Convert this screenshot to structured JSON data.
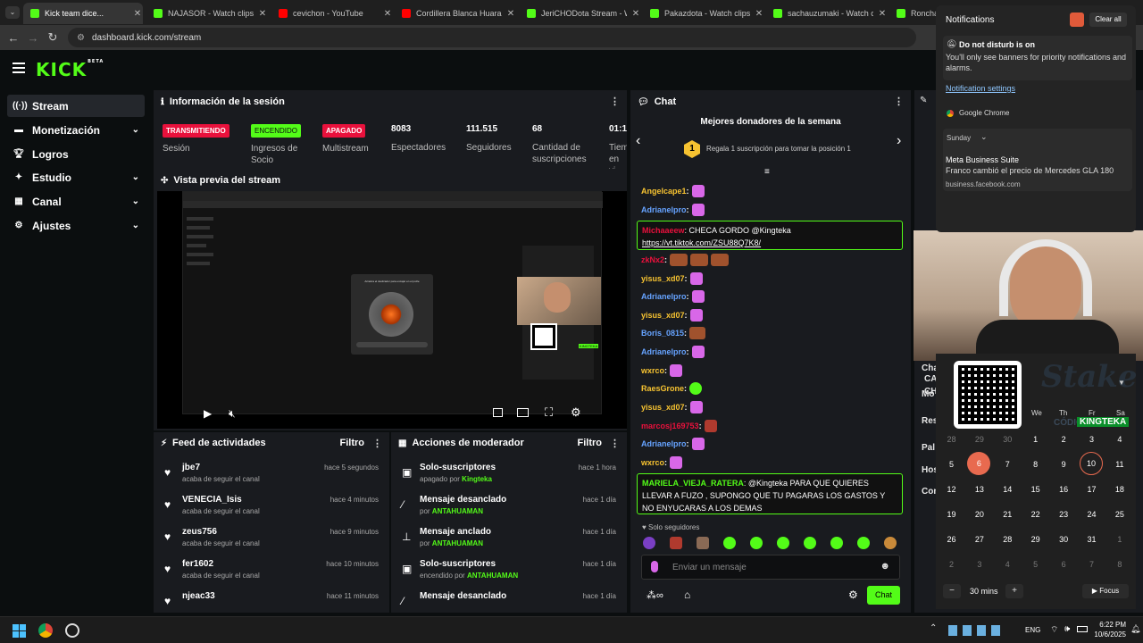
{
  "browser": {
    "tabs": [
      {
        "title": "Kick team dice...",
        "active": true,
        "fav": "#53fc18"
      },
      {
        "title": "NAJASOR - Watch clips o",
        "fav": "#53fc18"
      },
      {
        "title": "cevichon - YouTube",
        "fav": "#ff0000"
      },
      {
        "title": "Cordillera Blanca Huaraz",
        "fav": "#ff0000"
      },
      {
        "title": "JeriCHODota Stream - W",
        "fav": "#53fc18"
      },
      {
        "title": "Pakazdota - Watch clips o",
        "fav": "#53fc18"
      },
      {
        "title": "sachauzumaki - Watch cli",
        "fav": "#53fc18"
      },
      {
        "title": "Ronchas",
        "fav": "#53fc18"
      }
    ],
    "url": "dashboard.kick.com/stream"
  },
  "app": {
    "logo": "KICK",
    "logo_sup": "BETA"
  },
  "sidebar": {
    "items": [
      {
        "label": "Stream",
        "icon": "broadcast-icon"
      },
      {
        "label": "Monetización",
        "icon": "money-icon"
      },
      {
        "label": "Logros",
        "icon": "trophy-icon"
      },
      {
        "label": "Estudio",
        "icon": "studio-icon"
      },
      {
        "label": "Canal",
        "icon": "channel-icon"
      },
      {
        "label": "Ajustes",
        "icon": "gear-icon"
      }
    ]
  },
  "session": {
    "title": "Información de la sesión",
    "badges": [
      {
        "text": "TRANSMITIENDO",
        "label": "Sesión",
        "color": "#e9113c"
      },
      {
        "text": "ENCENDIDO",
        "label": "Ingresos de Socio",
        "color": "#53fc18"
      },
      {
        "text": "APAGADO",
        "label": "Multistream",
        "color": "#e9113c"
      }
    ],
    "stats": [
      {
        "value": "8083",
        "label": "Espectadores"
      },
      {
        "value": "111.515",
        "label": "Seguidores"
      },
      {
        "value": "68",
        "label": "Cantidad de suscripciones"
      },
      {
        "value": "01:1",
        "label": "Tiem en vi"
      }
    ]
  },
  "preview": {
    "title": "Vista previa del stream",
    "popup_text": "Arrastra el deslizador para encajar en el puzle",
    "qr_label": "KINGTEKA"
  },
  "feed": {
    "title": "Feed de actividades",
    "filter": "Filtro",
    "rows": [
      {
        "name": "jbe7",
        "sub": "acaba de seguir el canal",
        "time": "hace 5 segundos"
      },
      {
        "name": "VENECIA_Isis",
        "sub": "acaba de seguir el canal",
        "time": "hace 4 minutos"
      },
      {
        "name": "zeus756",
        "sub": "acaba de seguir el canal",
        "time": "hace 9 minutos"
      },
      {
        "name": "fer1602",
        "sub": "acaba de seguir el canal",
        "time": "hace 10 minutos"
      },
      {
        "name": "njeac33",
        "sub": "",
        "time": "hace 11 minutos"
      }
    ]
  },
  "mod": {
    "title": "Acciones de moderador",
    "filter": "Filtro",
    "rows": [
      {
        "name": "Solo-suscriptores",
        "pre": "apagado por",
        "by": "Kingteka",
        "time": "hace 1 hora"
      },
      {
        "name": "Mensaje desanclado",
        "pre": "por",
        "by": "ANTAHUAMAN",
        "time": "hace 1 día"
      },
      {
        "name": "Mensaje anclado",
        "pre": "por",
        "by": "ANTAHUAMAN",
        "time": "hace 1 día"
      },
      {
        "name": "Solo-suscriptores",
        "pre": "encendido por",
        "by": "ANTAHUAMAN",
        "time": "hace 1 día"
      },
      {
        "name": "Mensaje desanclado",
        "pre": "",
        "by": "",
        "time": "hace 1 día"
      }
    ]
  },
  "chat": {
    "title": "Chat",
    "donors_title": "Mejores donadores de la semana",
    "donor_rank": "1",
    "donor_text": "Regala 1 suscripción para tomar la posición 1",
    "messages": [
      {
        "user": "Angelcape1",
        "color": "#f7c331",
        "text": ":"
      },
      {
        "user": "Adrianelpro",
        "color": "#66a3ff",
        "text": ":"
      },
      {
        "user": "zkNx2",
        "color": "#e9113c",
        "text": ":"
      },
      {
        "user": "yisus_xd07",
        "color": "#f7c331",
        "text": ":"
      },
      {
        "user": "Adrianelpro",
        "color": "#66a3ff",
        "text": ":"
      },
      {
        "user": "yisus_xd07",
        "color": "#f7c331",
        "text": ":"
      },
      {
        "user": "Boris_0815",
        "color": "#66a3ff",
        "text": ":"
      },
      {
        "user": "Adrianelpro",
        "color": "#66a3ff",
        "text": ":"
      },
      {
        "user": "wxrco",
        "color": "#f7c331",
        "text": ":"
      },
      {
        "user": "RaesGrone",
        "color": "#f7c331",
        "text": ":"
      },
      {
        "user": "yisus_xd07",
        "color": "#f7c331",
        "text": ":"
      },
      {
        "user": "marcosj169753",
        "color": "#e9113c",
        "text": ":"
      },
      {
        "user": "Adrianelpro",
        "color": "#66a3ff",
        "text": ":"
      },
      {
        "user": "wxrco",
        "color": "#f7c331",
        "text": ":"
      }
    ],
    "highlight1": {
      "user": "Michaaeew",
      "text": ": CHECA GORDO @Kingteka",
      "link": "https://vt.tiktok.com/ZSU88Q7K8/"
    },
    "highlight2": {
      "user": "MARIELA_VIEJA_RATERA",
      "text": ": @Kingteka PARA QUE QUIERES LLEVAR A FUZO , SUPONGO QUE TU PAGARAS LOS GASTOS Y NO ENYUCARAS A LOS DEMAS"
    },
    "followers_only": "Solo seguidores",
    "input_placeholder": "Enviar un mensaje",
    "send_label": "Chat"
  },
  "right_panel": {
    "labels": [
      "CA",
      "CH",
      "Cha",
      "Mo",
      "Res",
      "Pal",
      "Hos",
      "Con"
    ]
  },
  "notifications": {
    "title": "Notifications",
    "clear_all": "Clear all",
    "dnd_title": "Do not disturb is on",
    "dnd_text": "You'll only see banners for priority notifications and alarms.",
    "settings_link": "Notification settings",
    "app_name": "Google Chrome",
    "group": "Sunday",
    "item_title": "Meta Business Suite",
    "item_body": "Franco cambió el precio de Mercedes GLA 180",
    "item_source": "business.facebook.com"
  },
  "calendar": {
    "weekday_headers": [
      "We",
      "Th",
      "Fr",
      "Sa"
    ],
    "rows": [
      [
        "28",
        "29",
        "30",
        "1",
        "2",
        "3",
        "4"
      ],
      [
        "5",
        "6",
        "7",
        "8",
        "9",
        "10",
        "11"
      ],
      [
        "12",
        "13",
        "14",
        "15",
        "16",
        "17",
        "18"
      ],
      [
        "19",
        "20",
        "21",
        "22",
        "23",
        "24",
        "25"
      ],
      [
        "26",
        "27",
        "28",
        "29",
        "30",
        "31",
        "1"
      ],
      [
        "2",
        "3",
        "4",
        "5",
        "6",
        "7",
        "8"
      ]
    ],
    "today": "6",
    "selected": "10",
    "focus_minutes": "30 mins",
    "focus_label": "Focus",
    "stake_code_label": "CÓDIGO",
    "stake_code": "KINGTEKA"
  },
  "taskbar": {
    "lang": "ENG",
    "time": "6:22 PM",
    "date": "10/6/2025"
  }
}
